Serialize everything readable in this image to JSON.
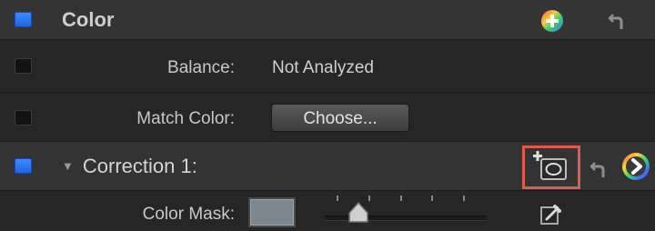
{
  "color_section": {
    "title": "Color"
  },
  "balance": {
    "label": "Balance:",
    "value": "Not Analyzed"
  },
  "match_color": {
    "label": "Match Color:",
    "button": "Choose..."
  },
  "correction": {
    "title": "Correction 1:"
  },
  "color_mask": {
    "label": "Color Mask:"
  },
  "icons": {
    "add_correction": "color-add-icon",
    "reset": "reset-arrow-icon",
    "add_shape_mask": "shape-mask-add-icon",
    "color_board": "color-board-arrow-icon",
    "eyedropper": "eyedropper-icon"
  },
  "colors": {
    "checkbox_blue": "#2f7bf5",
    "highlight": "#e05a4e",
    "mask_swatch": "#7d8790"
  }
}
